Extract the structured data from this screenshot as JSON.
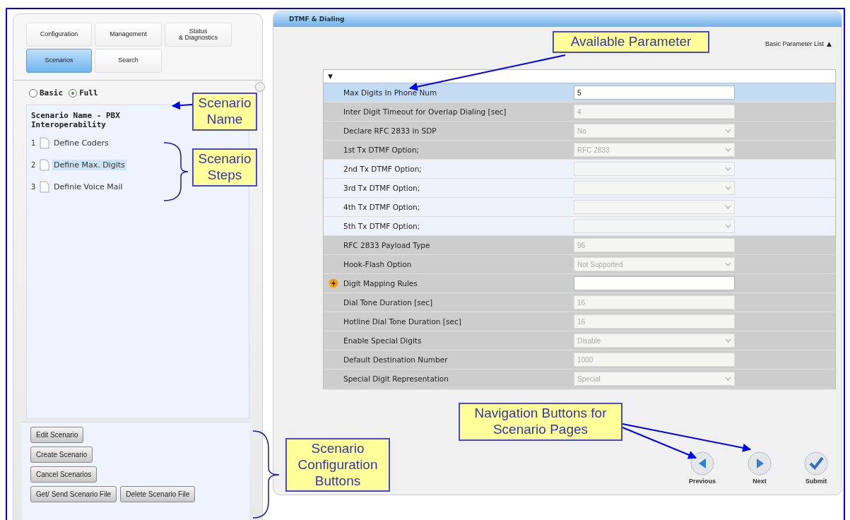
{
  "tabs": [
    {
      "label": "Configuration",
      "selected": false
    },
    {
      "label": "Management",
      "selected": false
    },
    {
      "label": "Status\n& Diagnostics",
      "selected": false
    },
    {
      "label": "Scenarios",
      "selected": true
    },
    {
      "label": "Search",
      "selected": false
    }
  ],
  "view_mode": [
    {
      "label": "Basic",
      "selected": false
    },
    {
      "label": "Full",
      "selected": true
    }
  ],
  "scenario": {
    "name": "Scenario Name - PBX Interoperability",
    "steps": [
      {
        "number": "1",
        "label": "Define Coders",
        "selected": false
      },
      {
        "number": "2",
        "label": "Define Max. Digits",
        "selected": true
      },
      {
        "number": "3",
        "label": "Definie Voice Mail",
        "selected": false
      }
    ]
  },
  "scenario_buttons": [
    [
      "Edit Scenario"
    ],
    [
      "Create Scenario"
    ],
    [
      "Cancel Scenarios"
    ],
    [
      "Get/ Send Scenario File",
      "Delete Scenario File"
    ]
  ],
  "page": {
    "title": "DTMF & Dialing",
    "list_toggle": "Basic Parameter List",
    "toggle_glyph": "▲",
    "collapse_glyph": "▼",
    "parameters": [
      {
        "label": "Max Digits In Phone Num",
        "value": "5",
        "kind": "input",
        "selected": true,
        "shaded": false,
        "disabled": false,
        "flagged": false
      },
      {
        "label": "Inter Digit Timeout for Overlap Dialing [sec]",
        "value": "4",
        "kind": "input",
        "selected": false,
        "shaded": true,
        "disabled": true,
        "flagged": false
      },
      {
        "label": "Declare RFC 2833 in SDP",
        "value": "No",
        "kind": "select",
        "selected": false,
        "shaded": true,
        "disabled": true,
        "flagged": false
      },
      {
        "label": "1st Tx DTMF Option;",
        "value": "RFC 2833",
        "kind": "select",
        "selected": false,
        "shaded": true,
        "disabled": true,
        "flagged": false
      },
      {
        "label": "2nd Tx DTMF Option;",
        "kind": "select",
        "selected": false,
        "shaded": false,
        "disabled": true,
        "flagged": false
      },
      {
        "label": "3rd Tx DTMF Option;",
        "kind": "select",
        "selected": false,
        "shaded": false,
        "disabled": true,
        "flagged": false
      },
      {
        "label": "4th Tx DTMF Option;",
        "kind": "select",
        "selected": false,
        "shaded": false,
        "disabled": true,
        "flagged": false
      },
      {
        "label": "5th Tx DTMF Option;",
        "kind": "select",
        "selected": false,
        "shaded": false,
        "disabled": true,
        "flagged": false
      },
      {
        "label": "RFC 2833 Payload Type",
        "value": "96",
        "kind": "input",
        "selected": false,
        "shaded": true,
        "disabled": true,
        "flagged": false
      },
      {
        "label": "Hook-Flash Option",
        "value": "Not Supported",
        "kind": "select",
        "selected": false,
        "shaded": true,
        "disabled": true,
        "flagged": false
      },
      {
        "label": "Digit Mapping Rules",
        "kind": "input",
        "selected": false,
        "shaded": true,
        "disabled": false,
        "flagged": true
      },
      {
        "label": "Dial Tone Duration [sec]",
        "value": "16",
        "kind": "input",
        "selected": false,
        "shaded": true,
        "disabled": true,
        "flagged": false
      },
      {
        "label": "Hotline Dial Tone Duration [sec]",
        "value": "16",
        "kind": "input",
        "selected": false,
        "shaded": true,
        "disabled": true,
        "flagged": false
      },
      {
        "label": "Enable Special Digits",
        "value": "Disable",
        "kind": "select",
        "selected": false,
        "shaded": true,
        "disabled": true,
        "flagged": false
      },
      {
        "label": "Default Destination Number",
        "value": "1000",
        "kind": "input",
        "selected": false,
        "shaded": true,
        "disabled": true,
        "flagged": false
      },
      {
        "label": "Special Digit Representation",
        "value": "Special",
        "kind": "select",
        "selected": false,
        "shaded": true,
        "disabled": true,
        "flagged": false
      }
    ]
  },
  "nav_buttons": [
    {
      "label": "Previous",
      "kind": "previous"
    },
    {
      "label": "Next",
      "kind": "next"
    },
    {
      "label": "Submit",
      "kind": "submit"
    }
  ],
  "callouts": [
    {
      "text": "Available Parameter"
    },
    {
      "text": "Scenario Name"
    },
    {
      "text": "Scenario Steps"
    },
    {
      "text": "Scenario Configuration Buttons"
    },
    {
      "text": "Navigation Buttons for Scenario Pages"
    }
  ]
}
